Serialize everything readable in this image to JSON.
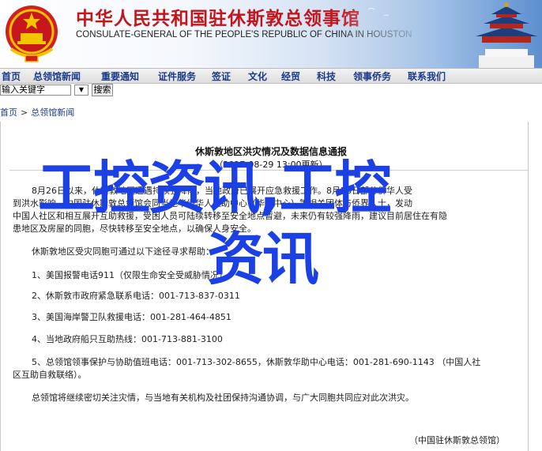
{
  "header": {
    "title_cn": "中华人民共和国驻休斯敦总领事馆",
    "title_en": "CONSULATE-GENERAL OF THE PEOPLE'S REPUBLIC OF CHINA IN HOUSTON"
  },
  "nav": {
    "items": [
      "首页",
      "总领馆新闻",
      "重要通知",
      "证件服务",
      "签证",
      "文化",
      "经贸",
      "科技",
      "领事侨务",
      "联系我们"
    ]
  },
  "search": {
    "value": "输入关键字",
    "button_label": "搜索"
  },
  "breadcrumb": {
    "items": [
      "首页",
      "总领馆新闻"
    ],
    "separator": ">"
  },
  "article": {
    "title": "休斯敦地区洪灾情况及数据信息通报",
    "date": "（2017-08-29 13:00更新）",
    "paragraphs": [
      "8月26日以来，休斯敦地区遭遇持续强降雨，当地政府已展开应急救援工作。8月28日部分侨华人受",
      "到洪水影响，中国驻休斯敦总领馆会同当地华侨华人互助中心（华助中心）等相关团体与侨界人士，发动",
      "中国人社区和相互展开互助救援，受困人员可陆续转移至安全地点暂避，未来仍有较强降雨，建议目前居住在有隐",
      "患地区及房屋的同胞，尽快转移至安全地点，以确保人身安全。",
      "休斯敦地区受灾同胞可通过以下途径寻求帮助："
    ],
    "list": [
      "1、美国报警电话911（仅限生命安全受威胁情况）",
      "2、休斯敦市政府紧急联系电话：001-713-837-0311",
      "3、美国海岸警卫队救援电话：001-281-464-4851",
      "4、当地政府船只互助热线：001-713-881-3100",
      "5、总领馆领事保护与协助值班电话：001-713-302-8655，休斯敦华助中心电话：001-281-690-1143 （中国人社",
      "区互助自救联络）。"
    ],
    "closing": "总领馆将继续密切关注灾情，与当地有关机构及社团保持沟通协调，与广大同胞共同应对此次洪灾。",
    "signature": "（中国驻休斯敦总领馆）"
  },
  "watermark": {
    "line1": "工控资讯,工控",
    "line2": "资讯"
  },
  "colors": {
    "title_red": "#c3151b",
    "nav_blue": "#1a3a8a",
    "watermark_blue": "#1a40e6"
  },
  "icons": {
    "emblem": "national-emblem-icon",
    "temple": "temple-of-heaven-image"
  }
}
